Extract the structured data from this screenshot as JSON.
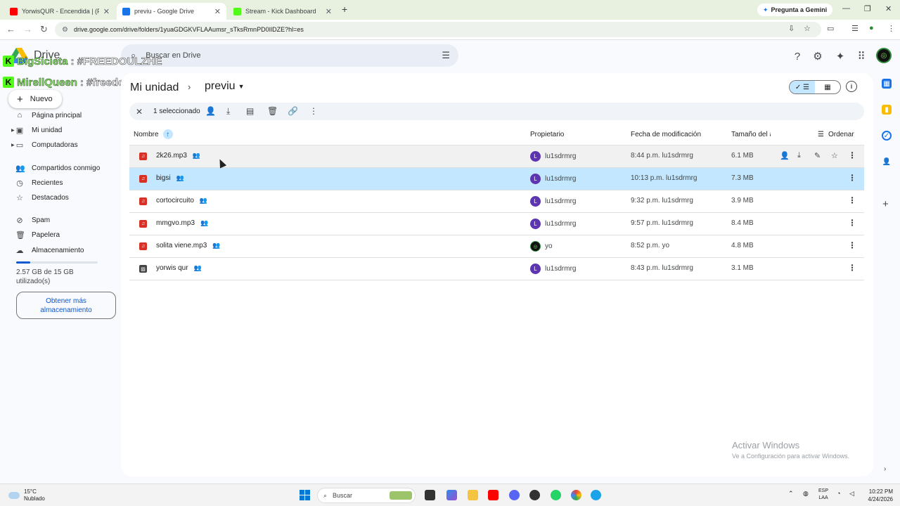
{
  "browser": {
    "tabs": [
      {
        "title": "YorwisQUR - Encendida | (Prod",
        "favicon_color": "#ff0000"
      },
      {
        "title": "previu - Google Drive",
        "favicon_color": "#1a73e8"
      },
      {
        "title": "Stream - Kick Dashboard",
        "favicon_color": "#53fc18"
      }
    ],
    "gemini_button": "Pregunta a Gemini",
    "url": "drive.google.com/drive/folders/1yuaGDGKVFLAAumsr_sTksRmnPD0IlDZE?hl=es"
  },
  "drive": {
    "app_name": "Drive",
    "search_placeholder": "Buscar en Drive",
    "new_button": "Nuevo",
    "overlay": [
      {
        "name": "BigSicieta",
        "tag": ": #FREEDOULZHE"
      },
      {
        "name": "MirellQueen",
        "tag": ": #freedoulzhe"
      }
    ],
    "nav": [
      {
        "label": "Página principal",
        "icon": "home-icon"
      },
      {
        "label": "Mi unidad",
        "icon": "my-drive-icon"
      },
      {
        "label": "Computadoras",
        "icon": "computers-icon"
      },
      {
        "label": "Compartidos conmigo",
        "icon": "shared-icon"
      },
      {
        "label": "Recientes",
        "icon": "clock-icon"
      },
      {
        "label": "Destacados",
        "icon": "star-icon"
      },
      {
        "label": "Spam",
        "icon": "spam-icon"
      },
      {
        "label": "Papelera",
        "icon": "trash-icon"
      },
      {
        "label": "Almacenamiento",
        "icon": "cloud-icon"
      }
    ],
    "storage": {
      "used_text": "2.57 GB de 15 GB utilizado(s)",
      "fraction": 0.17,
      "cta": "Obtener más almacenamiento"
    },
    "breadcrumb": {
      "parent": "Mi unidad",
      "current": "previu"
    },
    "selection": {
      "count_text": "1 seleccionado"
    },
    "columns": {
      "name": "Nombre",
      "owner": "Propietario",
      "modified": "Fecha de modificación",
      "size": "Tamaño del a",
      "sort": "Ordenar"
    },
    "files": [
      {
        "name": "2k26.mp3",
        "owner": "lu1sdrmrg",
        "owner_initial": "L",
        "modified": "8:44 p.m. lu1sdrmrg",
        "size": "6.1 MB",
        "type": "audio"
      },
      {
        "name": "bigsi",
        "owner": "lu1sdrmrg",
        "owner_initial": "L",
        "modified": "10:13 p.m. lu1sdrmrg",
        "size": "7.3 MB",
        "type": "audio"
      },
      {
        "name": "cortocircuito",
        "owner": "lu1sdrmrg",
        "owner_initial": "L",
        "modified": "9:32 p.m. lu1sdrmrg",
        "size": "3.9 MB",
        "type": "audio"
      },
      {
        "name": "mmgvo.mp3",
        "owner": "lu1sdrmrg",
        "owner_initial": "L",
        "modified": "9:57 p.m. lu1sdrmrg",
        "size": "8.4 MB",
        "type": "audio"
      },
      {
        "name": "solita viene.mp3",
        "owner": "yo",
        "owner_initial": "",
        "modified": "8:52 p.m. yo",
        "size": "4.8 MB",
        "type": "audio"
      },
      {
        "name": "yorwis qur",
        "owner": "lu1sdrmrg",
        "owner_initial": "L",
        "modified": "8:43 p.m. lu1sdrmrg",
        "size": "3.1 MB",
        "type": "image"
      }
    ],
    "watermark": {
      "title": "Activar Windows",
      "subtitle": "Ve a Configuración para activar Windows."
    }
  },
  "taskbar": {
    "temp": "15°C",
    "weather": "Nublado",
    "search": "Buscar",
    "lang_top": "ESP",
    "lang_bottom": "LAA",
    "time": "10:22 PM",
    "date": "4/24/2026"
  }
}
